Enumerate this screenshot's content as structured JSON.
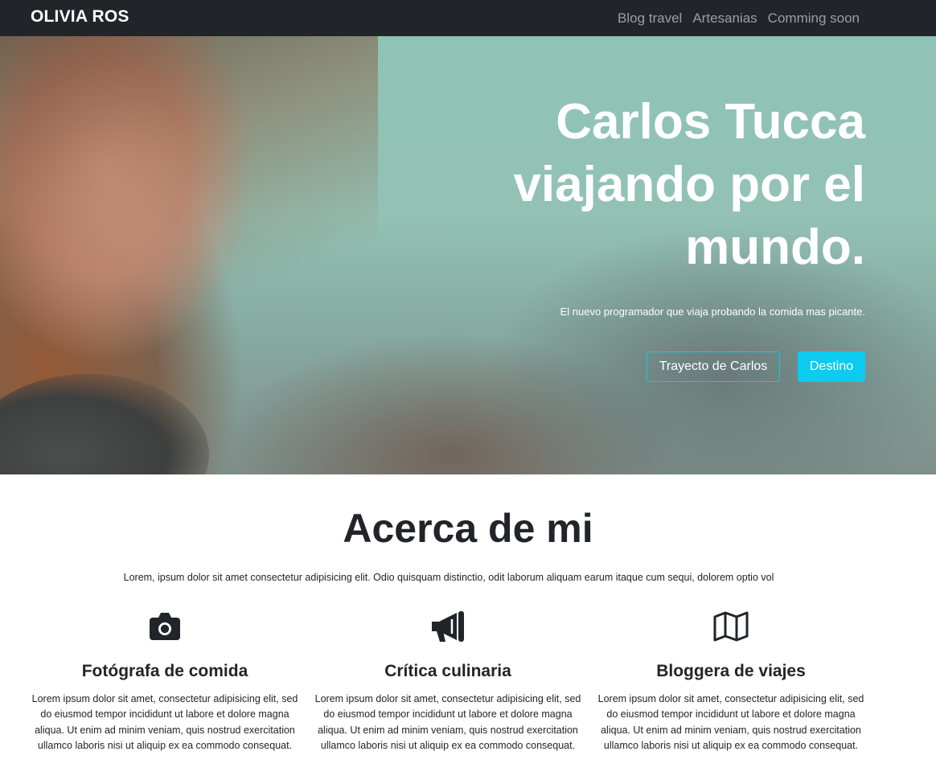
{
  "navbar": {
    "brand": "OLIVIA ROS",
    "links": [
      "Blog travel",
      "Artesanias",
      "Comming soon"
    ]
  },
  "hero": {
    "title": "Carlos Tucca viajando por el mundo.",
    "subtitle": "El nuevo programador que viaja probando la comida mas picante.",
    "button_primary": "Trayecto de Carlos",
    "button_secondary": "Destino",
    "accent_color": "#0dcaf0"
  },
  "about": {
    "title": "Acerca de mi",
    "intro": "Lorem, ipsum dolor sit amet consectetur adipisicing elit. Odio quisquam distinctio, odit laborum aliquam earum itaque cum sequi, dolorem optio vol",
    "features": [
      {
        "icon": "camera-icon",
        "title": "Fotógrafa de comida",
        "text": "Lorem ipsum dolor sit amet, consectetur adipisicing elit, sed do eiusmod tempor incididunt ut labore et dolore magna aliqua. Ut enim ad minim veniam, quis nostrud exercitation ullamco laboris nisi ut aliquip ex ea commodo consequat."
      },
      {
        "icon": "megaphone-icon",
        "title": "Crítica culinaria",
        "text": "Lorem ipsum dolor sit amet, consectetur adipisicing elit, sed do eiusmod tempor incididunt ut labore et dolore magna aliqua. Ut enim ad minim veniam, quis nostrud exercitation ullamco laboris nisi ut aliquip ex ea commodo consequat."
      },
      {
        "icon": "map-icon",
        "title": "Bloggera de viajes",
        "text": "Lorem ipsum dolor sit amet, consectetur adipisicing elit, sed do eiusmod tempor incididunt ut labore et dolore magna aliqua. Ut enim ad minim veniam, quis nostrud exercitation ullamco laboris nisi ut aliquip ex ea commodo consequat."
      }
    ]
  }
}
